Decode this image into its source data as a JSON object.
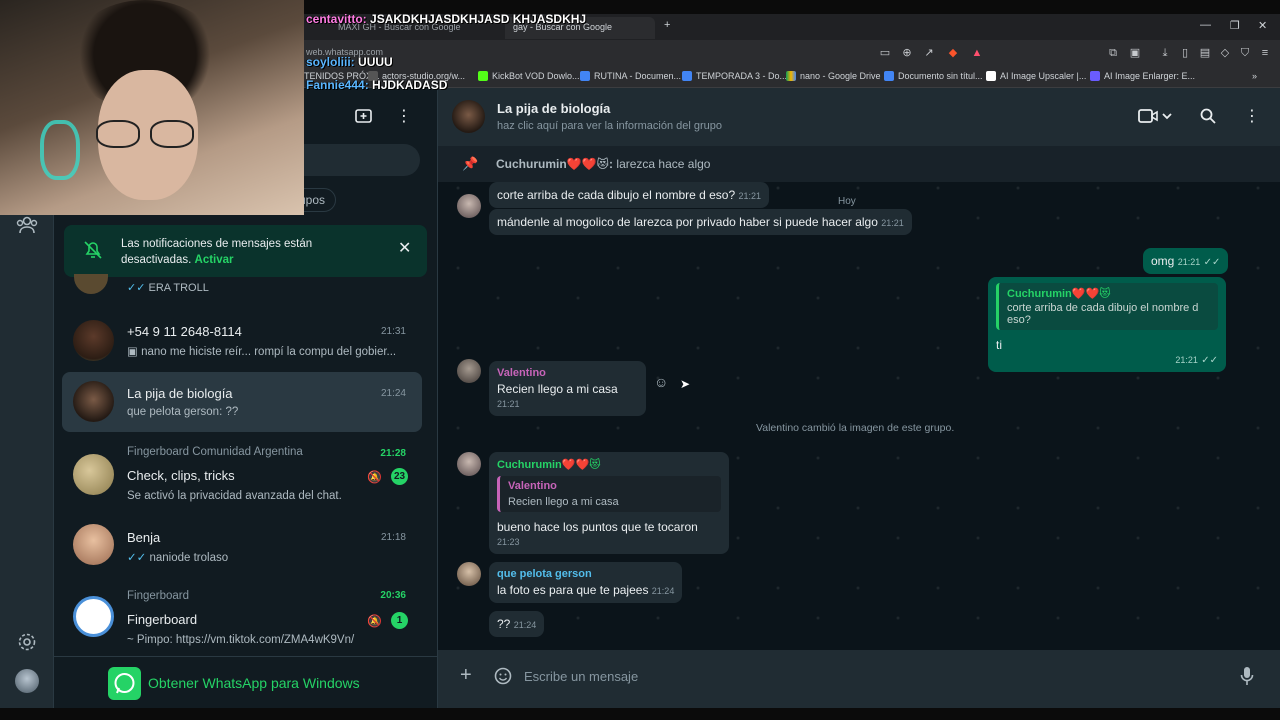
{
  "browser": {
    "tabs": [
      {
        "label": "MAXI GH - Buscar con Google"
      },
      {
        "label": "gay - Buscar con Google"
      }
    ],
    "url": "web.whatsapp.com",
    "bookmarks": [
      "TENIDOS PRÓX...",
      "actors-studio.org/w...",
      "KickBot VOD Dowlo...",
      "RUTINA - Documen...",
      "TEMPORADA 3 - Do...",
      "nano - Google Drive",
      "Documento sin títul...",
      "AI Image Upscaler |...",
      "AI Image Enlarger: E..."
    ]
  },
  "stream_chat": [
    {
      "user": "centavitto:",
      "text": "JSAKDKHJASDKHJASD KHJASDKHJ"
    },
    {
      "user": "soyloliii:",
      "text": "UUUU"
    },
    {
      "user": "Fannie444:",
      "text": "HJDKADASD"
    }
  ],
  "sidebar": {
    "filter_chip": "rupos",
    "notification_banner": {
      "text": "Las notificaciones de mensajes están desactivadas.",
      "action": "Activar"
    },
    "partial_row_preview": "ERA TROLL",
    "chats": [
      {
        "name": "+54 9 11 2648-8114",
        "time": "21:31",
        "preview": "nano me hiciste reír... rompí la compu del gobier...",
        "preview_icon": "image-icon"
      },
      {
        "name": "La pija de biología",
        "time": "21:24",
        "preview": "que pelota gerson: ??"
      },
      {
        "group": "Fingerboard Comunidad Argentina",
        "name": "Check, clips, tricks",
        "time": "21:28",
        "preview": "Se activó la privacidad avanzada del chat.",
        "unread": "23",
        "muted": true
      },
      {
        "name": "Benja",
        "time": "21:18",
        "preview": "naniode trolaso"
      },
      {
        "group": "Fingerboard",
        "name": "Fingerboard",
        "time": "20:36",
        "preview": "~ Pimpo: https://vm.tiktok.com/ZMA4wK9Vn/",
        "unread": "1",
        "muted": true
      }
    ],
    "get_app": "Obtener WhatsApp para Windows"
  },
  "chat": {
    "title": "La pija de biología",
    "subtitle": "haz clic aquí para ver la información del grupo",
    "pinned": {
      "sender": "Cuchurumin❤️❤️😻:",
      "text": "larezca hace algo"
    },
    "day_label": "Hoy",
    "messages": [
      {
        "id": "m1",
        "text": "corte arriba de cada dibujo el nombre d eso?",
        "time": "21:21"
      },
      {
        "id": "m2",
        "text": "mándenle al mogolico de larezca por privado haber si puede hacer algo",
        "time": "21:21"
      },
      {
        "id": "m3",
        "text": "omg",
        "time": "21:21"
      },
      {
        "id": "m4",
        "quote_sender": "Cuchurumin❤️❤️😻",
        "quote_text": "corte arriba de cada dibujo el nombre d eso?",
        "text": "ti",
        "time": "21:21"
      },
      {
        "id": "m5",
        "sender": "Valentino",
        "text": "Recien llego a mi casa",
        "time": "21:21"
      },
      {
        "id": "sys",
        "text": "Valentino cambió la imagen de este grupo."
      },
      {
        "id": "m6",
        "sender": "Cuchurumin❤️❤️😻",
        "quote_sender": "Valentino",
        "quote_text": "Recien llego a mi casa",
        "text": "bueno hace los puntos que te tocaron",
        "time": "21:23"
      },
      {
        "id": "m7",
        "sender": "que pelota gerson",
        "text": "la foto es para que te pajees",
        "time": "21:24"
      },
      {
        "id": "m8",
        "text": "??",
        "time": "21:24"
      }
    ],
    "composer_placeholder": "Escribe un mensaje"
  },
  "colors": {
    "accent": "#25d366",
    "outgoing": "#005c4b",
    "incoming": "#202c33",
    "valentino": "#c764b9",
    "cuchurumin": "#25d366",
    "gerson": "#53bdeb"
  }
}
